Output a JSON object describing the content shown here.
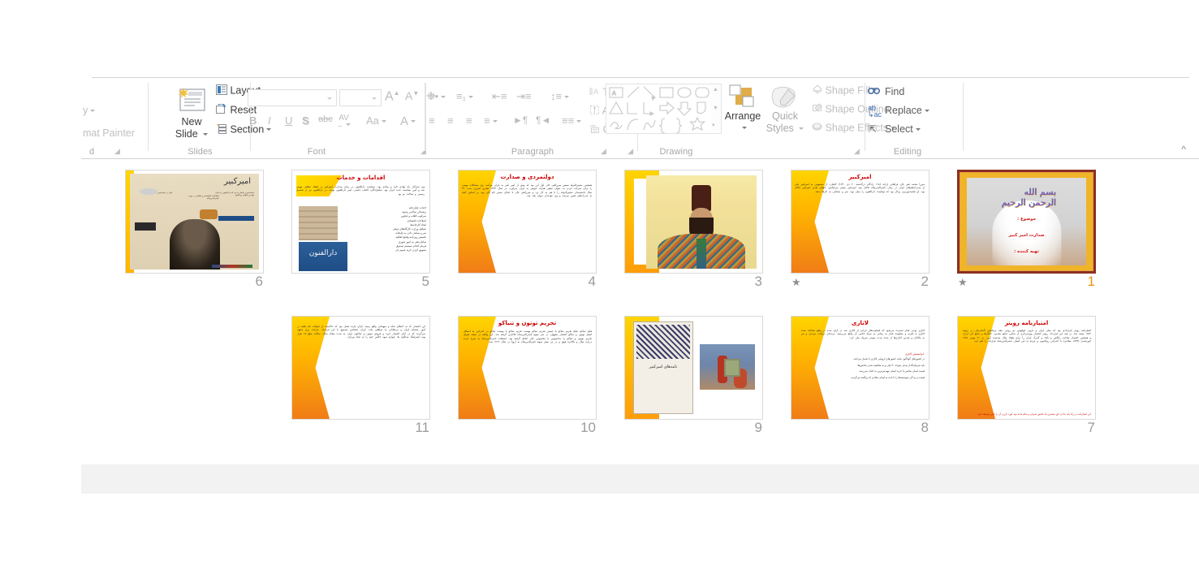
{
  "app": {
    "name": "Microsoft PowerPoint",
    "view": "Slide Sorter"
  },
  "ribbon": {
    "groups": [
      {
        "name": "Clipboard",
        "label": "d",
        "items": [
          {
            "label": "y",
            "icon": "clipboard-style-icon",
            "has_caret": true
          },
          {
            "label": "mat Painter",
            "icon": "format-painter-icon",
            "has_caret": false
          }
        ]
      },
      {
        "name": "Slides",
        "label": "Slides",
        "items": [
          {
            "label": "New Slide",
            "icon": "new-slide-icon",
            "has_caret": true
          },
          {
            "label": "Layout",
            "icon": "layout-icon",
            "has_caret": true
          },
          {
            "label": "Reset",
            "icon": "reset-icon",
            "has_caret": false
          },
          {
            "label": "Section",
            "icon": "section-icon",
            "has_caret": true
          }
        ]
      },
      {
        "name": "Font",
        "label": "Font",
        "font_name_value": "",
        "font_name_placeholder": "",
        "font_size_value": "",
        "font_size_placeholder": "",
        "items": [
          {
            "label": "A",
            "icon": "increase-font-size-icon"
          },
          {
            "label": "A",
            "icon": "decrease-font-size-icon"
          },
          {
            "label": "",
            "icon": "clear-formatting-icon"
          },
          {
            "label": "B",
            "icon": "bold-icon"
          },
          {
            "label": "I",
            "icon": "italic-icon"
          },
          {
            "label": "U",
            "icon": "underline-icon"
          },
          {
            "label": "S",
            "icon": "text-shadow-icon"
          },
          {
            "label": "abc",
            "icon": "strikethrough-icon"
          },
          {
            "label": "AV",
            "icon": "character-spacing-icon"
          },
          {
            "label": "Aa",
            "icon": "change-case-icon"
          },
          {
            "label": "A",
            "icon": "font-color-icon"
          }
        ]
      },
      {
        "name": "Paragraph",
        "label": "Paragraph",
        "items": [
          {
            "label": "Text Direction",
            "icon": "text-direction-icon",
            "has_caret": true
          },
          {
            "label": "Align Text",
            "icon": "align-text-icon",
            "has_caret": true
          },
          {
            "label": "Convert to SmartArt",
            "icon": "convert-to-smartart-icon",
            "has_caret": true
          }
        ]
      },
      {
        "name": "Drawing",
        "label": "Drawing",
        "items": [
          {
            "label": "Arrange",
            "icon": "arrange-icon",
            "has_caret": true
          },
          {
            "label": "Quick Styles",
            "icon": "quick-styles-icon",
            "has_caret": true
          },
          {
            "label": "Shape Fill",
            "icon": "shape-fill-icon",
            "has_caret": true
          },
          {
            "label": "Shape Outline",
            "icon": "shape-outline-icon",
            "has_caret": true
          },
          {
            "label": "Shape Effects",
            "icon": "shape-effects-icon",
            "has_caret": true
          }
        ]
      },
      {
        "name": "Editing",
        "label": "Editing",
        "items": [
          {
            "label": "Find",
            "icon": "find-icon",
            "has_caret": false
          },
          {
            "label": "Replace",
            "icon": "replace-icon",
            "has_caret": true
          },
          {
            "label": "Select",
            "icon": "select-icon",
            "has_caret": true
          }
        ]
      }
    ],
    "collapse_icon": "collapse-ribbon-chevron-icon"
  },
  "colors": {
    "selection_border": "#8c2f22",
    "selected_number": "#e8930f",
    "number": "#9b9b9b",
    "slide_title_red": "#cc0000",
    "accent_yellow": "#ffd400",
    "accent_orange": "#f07c17",
    "ribbon_label": "#a8a8a8"
  },
  "slides": [
    {
      "number": "6",
      "animation_star": "",
      "selected": false,
      "kind": "poster",
      "title": "",
      "body": ""
    },
    {
      "number": "5",
      "animation_star": "",
      "selected": false,
      "kind": "bullets-with-photos",
      "title": "اقدامات و خدمات",
      "sign_text": "دارالفنون",
      "body": "وی سرآغاز راه نهادی تازه و بنیادی بود. سیاست دارالفنون در زمان صدارت امیرکبیر در نقطه عطفی مهمی شد و آیین سیاست جدید ایران بود. شاهزادگان، القاب خاصی، امیر دارالفنون بودند. در دارالفنون نیز از تحصیل رسمی و ساخت نو بود",
      "list": [
        "احداث چاپارخانه",
        "ریشه‌کن ساختن رشوه",
        "سرکوب القاب و عناوین",
        "اصلاحات اقتصادی",
        "ایجاد کارخانه‌ها",
        "تشکیل وزارت کارگاه‌های دولتی",
        "سر و سامان دادن به چاپخانه",
        "تاسیس روزنامه وقایع اتفاقیه",
        "سامان‌دهی به امور شهری",
        "فرمان اقدام سیستم صندوق",
        "تشویق کردن خرید عموم نان"
      ]
    },
    {
      "number": "4",
      "animation_star": "",
      "selected": false,
      "kind": "text",
      "title": "دولتمردی و صدارت",
      "body": "همچنین مشیرالدوله سپس میرزاتقی خان اول این بود که پیش از امیر کبیر به ایران می‌آمد. وی مشکلات مهمی را برای شرکت کردن به عنوان سفیر همراه خویش به ایران می‌آورد. در سال ۱۲۴۳ هجری قمری، مدت ۲۲ سال دانشمندان مشیرالدوله را با هم به کار برد و میرزاتقی خان تا امکان بستن نام آنان بود. بر اساس آنچه به صدراعظم تعیین می‌شد و وی عهده‌دار دیوان بلند شد."
    },
    {
      "number": "3",
      "animation_star": "",
      "selected": false,
      "kind": "portrait",
      "title": "",
      "body": ""
    },
    {
      "number": "2",
      "animation_star": "★",
      "selected": false,
      "kind": "text",
      "title": "امیرکبیر",
      "body": "میرزا محمد تقی خان فراهانی (زاده ۱۱۸۶ زادگان درگذشته ۲۰ دی ۱۲۳۰) کاشان، از منسوبین به امیرکبیر یکی از صدراعظم‌های ایران در زمان ناصرالدین‌شاه قاجار بود. امیرکبیر مسیر مردم‌آمیز، خواهر تقدیر امیرکبیر قاجار بود. او نخست‌وزیری پرکار بود که توانست دارالفنون را بنیان نهد، سر و سامانی به کارها بدهد."
    },
    {
      "number": "1",
      "animation_star": "★",
      "selected": true,
      "kind": "title-slide",
      "basmala": "بسم الله الرحمن الرحیم",
      "lines": [
        "موضوع :",
        "صدارت امیر کبیر",
        "تهیه کننده :"
      ]
    },
    {
      "number": "11",
      "animation_star": "",
      "selected": false,
      "kind": "text",
      "title": "",
      "body": "این انحصار که به اعطای شاه و میهمانی واقع رسید دارای یازده فصل بود که حاکمیت از تحولات نام تقلید در امور متشابه ایران و بی‌تعادلی به منطقی ماند. ایران مشخص مصنوع با این قرارداد، شرکت رژی متعهد می‌گردید که در ازای انحصار خرید و فروش توتون و تنباکوی ایران به مدت پنجاه سال، سالانه مبلغ ۱۵ هزار پوند استرلینگ به‌علاوه یک چهارم سود خالص خود را به شاه بپردازد."
    },
    {
      "number": "10",
      "animation_star": "",
      "selected": false,
      "kind": "text",
      "title": "تحریم توتون و تنباکو",
      "body": "قیام تنباکو، قیام تحریم تنباکو یا جنبش تحریم تنباکو نهضت تحریم تنباکو با نهضت تنباکو در اعتراض به اعطای امتیاز توتون و تنباکو انحصار مجهول، در سر سوم ناصرالدین‌شاه قاجاری گرفته شد. این واقعه در نتیجه فتوای تحریم توتون و تنباکو را به‌خصوص با محصوص خان انجام گرفته بود. استفاده ناصرالدین‌شاه به شرح کرده درباره سال و بالاخره فوق و در پی سفر سوم ناصرالدین‌شاه به اروپا در سال ۱۲۶۹ شد."
    },
    {
      "number": "9",
      "animation_star": "",
      "selected": false,
      "kind": "two-images",
      "book_title": "نامه‌های امیرکبیر",
      "title": "",
      "body": ""
    },
    {
      "number": "8",
      "animation_star": "",
      "selected": false,
      "kind": "text",
      "title": "لاتاری",
      "subtitle": "فرانسیس لاتاری",
      "body": "لاتاری نوعی قمار شمرده می‌شود که قضاوت‌های ایرانی از لاتاری شد در ازای شده در واقع شناخته شده لاتاری با تناوب و معاوضه قمار به زمانی به مزایا حکمی آن واقع می‌رسید، برنده‌ای دریافت می‌کرد و نیز به مالکان و چندین لاتاری‌ها از شده مدت نمودن شریک بیان کرد.",
      "list": [
        "در کشورهای گوناگون مانند کشورهای اروپایی لاتاری با تحمل می‌کنند.",
        "باید سرمایه‌گذار تبدیل به‌وجه ۳۰ بیان و به مقایسه شدن شانس‌ها.",
        "قیمت لیمان مختص با خرید لیمان مهندس‌ترین به اثبات می‌رسد.",
        "قیمت و زندگی موسسه‌ها را با ایده به لیمان مفادی که پرگفته می‌گردید."
      ]
    },
    {
      "number": "7",
      "animation_star": "",
      "selected": false,
      "kind": "text",
      "title": "امتیازنامه رویتر",
      "body": "امتیازنامه رویتر قراردادی بود که میان ایران و بارون جولیوس دو رویتر، تبعه بریتانیایی آلمانی‌تبار، در ژوئیه ۱۸۷۲ بسته شد. بر پایه این قرارداد، رویتر انحصار بهره‌برداری از تمامی منابع معدنی، جنگل‌ها و منابع آبی ایران و همچنین انحصار ساخت راه‌آهن و بانک و گمرک ایران را برای هفتاد سال به‌دست آورد. در ۲۱ بهمن ۱۲۵۱ خورشیدی (۱۸۷۳ میلادی) با اعتراض روحانیون و مردم به این امتیاز، ناصرالدین‌شاه قرارداد را لغو کرد.",
      "footer": "این امتیازنامه در راه پایه ندادن حق بیشتری یک کشور شرقی و تمام شده بود، لورد کرزن آن را چنین توصیف کرد."
    }
  ]
}
